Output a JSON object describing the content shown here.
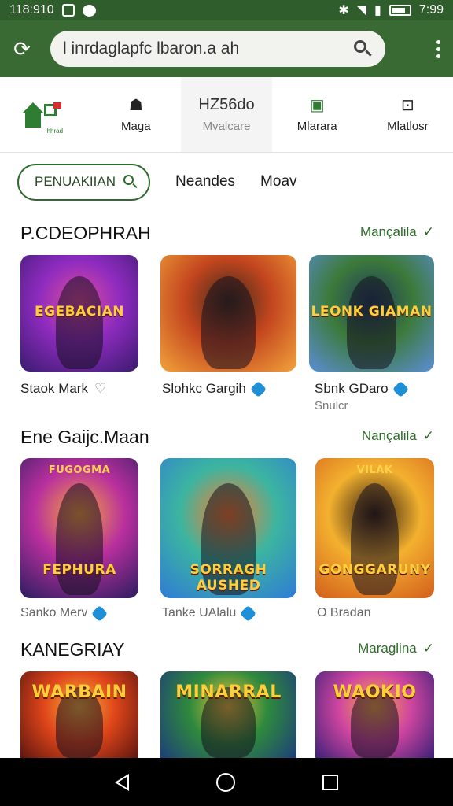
{
  "status_bar": {
    "time": "118:910",
    "clock": "7:99"
  },
  "browser": {
    "search_text": "l inrdaglapfc lbaron.a ah"
  },
  "tabs": [
    {
      "label": "Maga",
      "icon": "game-icon"
    },
    {
      "label": "Mvalcare",
      "top_text": "HZ56do",
      "icon": "text-icon"
    },
    {
      "label": "Mlarara",
      "icon": "image-icon"
    },
    {
      "label": "Mlatlosr",
      "icon": "controller-icon"
    }
  ],
  "logo": {
    "caption": "hhrad"
  },
  "filters": {
    "search_pill": "PENUAKIIAN",
    "chip1": "Neandes",
    "chip2": "Moav"
  },
  "sections": [
    {
      "title": "P.CDEOPHRAH",
      "more": "Mançalila",
      "cards": [
        {
          "title": "Staok Mark",
          "badge": "heart",
          "art_text": "EGEBACIAN",
          "colors": [
            "#3a1b6e",
            "#8e2bbf",
            "#e04d9c"
          ]
        },
        {
          "title": "Slohkc Gargih",
          "badge": "verified",
          "art_text": "",
          "colors": [
            "#f2a33a",
            "#c4461f",
            "#3b2a1a"
          ]
        },
        {
          "title": "Sbnk GDaro",
          "sub": "Snulcr",
          "badge": "verified",
          "art_text": "LEONK GIAMAN",
          "colors": [
            "#5b8ed6",
            "#3c7a3a",
            "#1f3b5c"
          ]
        }
      ]
    },
    {
      "title": "Ene Gaijc.Maan",
      "more": "Nançalila",
      "cards": [
        {
          "title": "Sanko Merv",
          "badge": "verified",
          "art_text": "FEPHURA",
          "top_text": "FUGOGMA",
          "colors": [
            "#2b1d5e",
            "#b82f9e",
            "#f6a53c"
          ]
        },
        {
          "title": "Tanke UAlalu",
          "badge": "verified",
          "art_text": "SORRAGH AUSHED",
          "colors": [
            "#2f7bd6",
            "#3cb5a0",
            "#ff7a2b"
          ]
        },
        {
          "title": "O Bradan",
          "badge": "",
          "art_text": "GONGGARUNY",
          "top_text": "VILAK",
          "colors": [
            "#d35e1c",
            "#f3b12f",
            "#2f1c10"
          ]
        }
      ]
    },
    {
      "title": "KANEGRIAY",
      "more": "Maraglina",
      "cards": [
        {
          "art_text": "WARBAIN",
          "colors": [
            "#5a140f",
            "#e0461a",
            "#f6b23c"
          ]
        },
        {
          "art_text": "MINARRAL",
          "colors": [
            "#1d3d7a",
            "#2f8a3c",
            "#f0c23a"
          ]
        },
        {
          "art_text": "WAOKIO",
          "colors": [
            "#3a1f78",
            "#d046a0",
            "#f6a843"
          ]
        }
      ]
    }
  ],
  "colors": {
    "brand_green": "#3a6a33",
    "accent_blue": "#1f8fd6"
  }
}
